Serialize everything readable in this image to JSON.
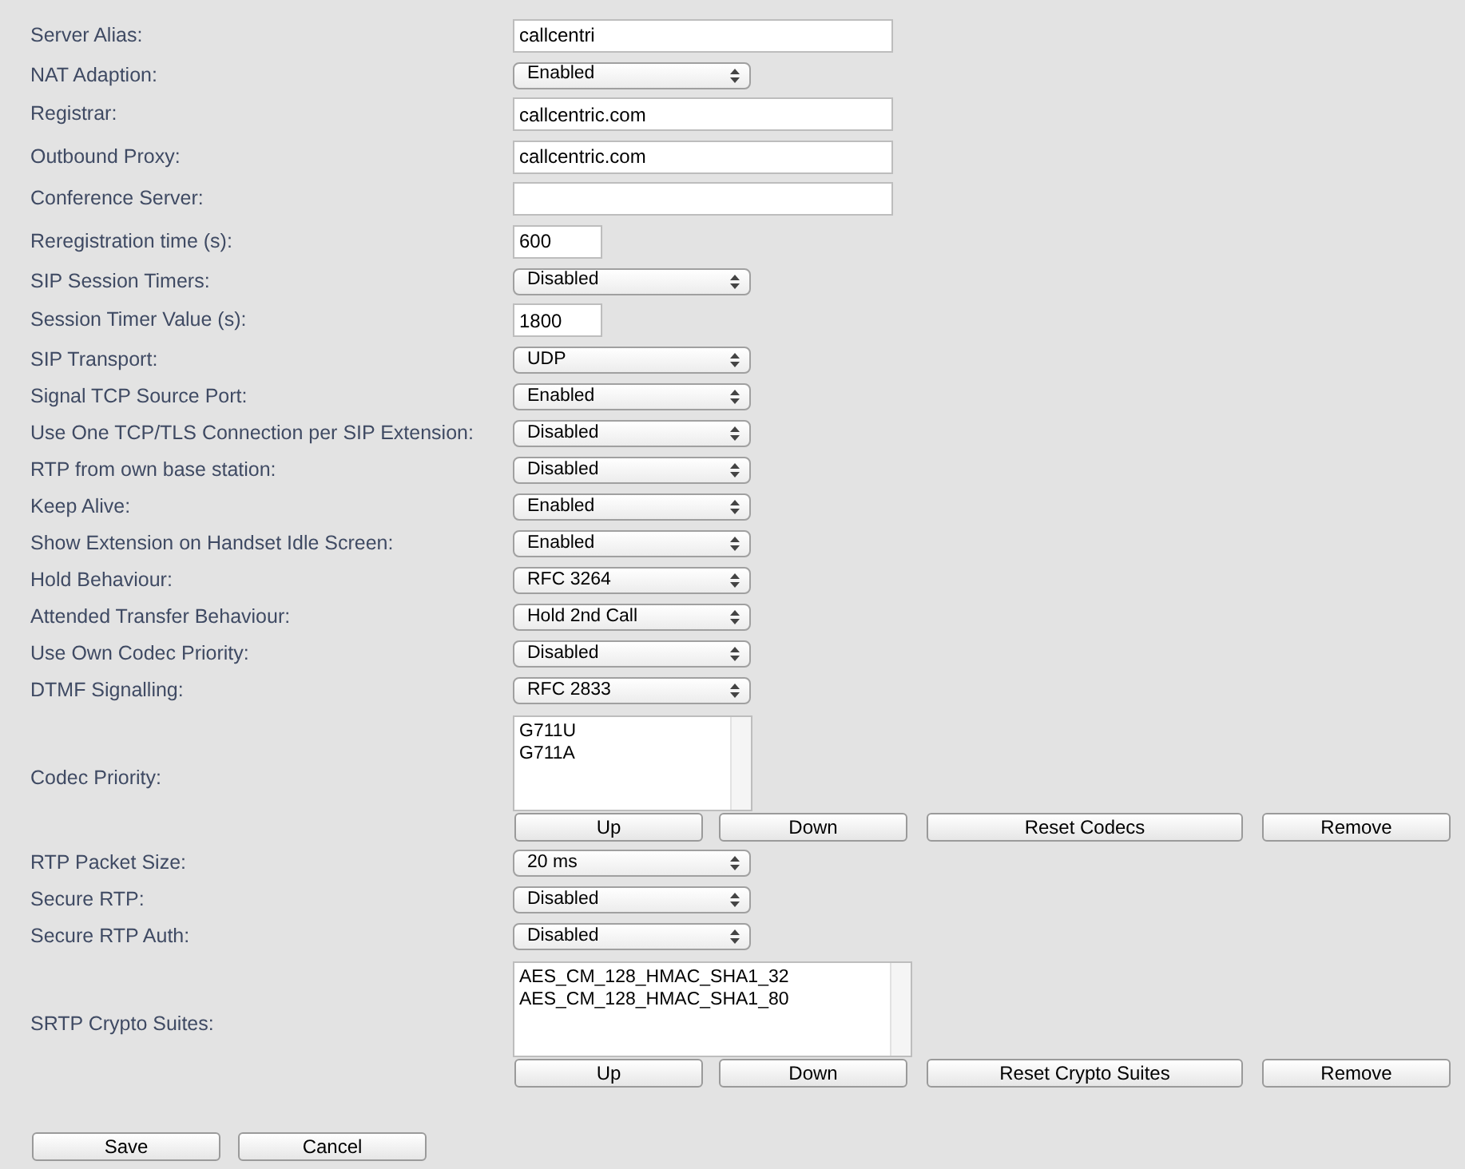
{
  "rows": [
    {
      "label": "Server Alias:",
      "kind": "text",
      "value": "callcentri"
    },
    {
      "label": "NAT Adaption:",
      "kind": "select",
      "value": "Enabled"
    },
    {
      "label": "Registrar:",
      "kind": "text",
      "value": "callcentric.com"
    },
    {
      "label": "Outbound Proxy:",
      "kind": "text",
      "value": "callcentric.com"
    },
    {
      "label": "Conference Server:",
      "kind": "text"
    },
    {
      "label": "Reregistration time (s):",
      "kind": "number",
      "value": "600"
    },
    {
      "label": "SIP Session Timers:",
      "kind": "select",
      "value": "Disabled"
    },
    {
      "label": "Session Timer Value (s):",
      "kind": "number",
      "value": "1800"
    },
    {
      "label": "SIP Transport:",
      "kind": "select",
      "value": "UDP"
    },
    {
      "label": "Signal TCP Source Port:",
      "kind": "select",
      "value": "Enabled"
    },
    {
      "label": "Use One TCP/TLS Connection per SIP Extension:",
      "kind": "select",
      "value": "Disabled"
    },
    {
      "label": "RTP from own base station:",
      "kind": "select",
      "value": "Disabled"
    },
    {
      "label": "Keep Alive:",
      "kind": "select",
      "value": "Enabled"
    },
    {
      "label": "Show Extension on Handset Idle Screen:",
      "kind": "select",
      "value": "Enabled"
    },
    {
      "label": "Hold Behaviour:",
      "kind": "select",
      "value": "RFC 3264"
    },
    {
      "label": "Attended Transfer Behaviour:",
      "kind": "select",
      "value": "Hold 2nd Call"
    },
    {
      "label": "Use Own Codec Priority:",
      "kind": "select",
      "value": "Disabled"
    },
    {
      "label": "DTMF Signalling:",
      "kind": "select",
      "value": "RFC 2833"
    },
    {
      "label": "Codec Priority:",
      "kind": "list",
      "items": [
        "G711U",
        "G711A"
      ],
      "buttons": [
        "Up",
        "Down",
        "Reset Codecs",
        "Remove"
      ]
    },
    {
      "label": "RTP Packet Size:",
      "kind": "select",
      "value": "20 ms"
    },
    {
      "label": "Secure RTP:",
      "kind": "select",
      "value": "Disabled"
    },
    {
      "label": "Secure RTP Auth:",
      "kind": "select",
      "value": "Disabled"
    },
    {
      "label": "SRTP Crypto Suites:",
      "kind": "list",
      "items": [
        "AES_CM_128_HMAC_SHA1_32",
        "AES_CM_128_HMAC_SHA1_80"
      ],
      "buttons": [
        "Up",
        "Down",
        "Reset Crypto Suites",
        "Remove"
      ]
    }
  ],
  "buttons": [
    "Save",
    "Cancel"
  ]
}
